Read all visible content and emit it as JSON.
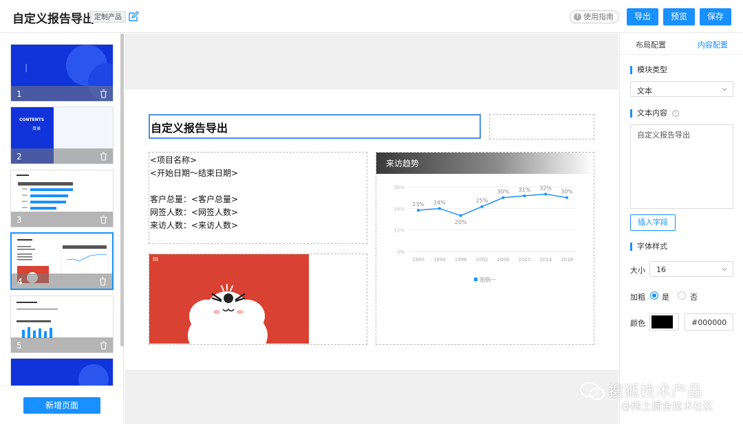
{
  "header": {
    "title": "自定义报告导出",
    "tag": "定制产品",
    "guide_label": "使用指南",
    "export_label": "导出",
    "preview_label": "预览",
    "save_label": "保存"
  },
  "pages": [
    {
      "num": "1"
    },
    {
      "num": "2",
      "contents_title": "CONTENTS",
      "contents_sub": "目录"
    },
    {
      "num": "3"
    },
    {
      "num": "4"
    },
    {
      "num": "5"
    }
  ],
  "add_page_label": "新增页面",
  "slide": {
    "title": "自定义报告导出",
    "text_lines": [
      "<项目名称>",
      "<开始日期～结束日期>",
      "",
      "客户总量：<客户总量>",
      "网签人数：<网签人数>",
      "来访人数：<来访人数>"
    ],
    "chart_header": "来访趋势"
  },
  "chart_data": {
    "type": "line",
    "title": "来访趋势",
    "categories": [
      "1990",
      "1994",
      "1998",
      "2002",
      "2006",
      "2010",
      "2014",
      "2018"
    ],
    "series": [
      {
        "name": "图例一",
        "values": [
          23,
          24,
          20,
          25,
          30,
          31,
          32,
          30
        ]
      }
    ],
    "data_labels": [
      "23%",
      "24%",
      "20%",
      "25%",
      "30%",
      "31%",
      "32%",
      "30%"
    ],
    "y_ticks": [
      "0%",
      "12%",
      "24%",
      "36%"
    ],
    "ylim": [
      0,
      36
    ],
    "grid": true,
    "legend": "bottom",
    "color": "#1890ff"
  },
  "panel": {
    "tab_layout": "布局配置",
    "tab_content": "内容配置",
    "module_type_label": "模块类型",
    "module_type_value": "文本",
    "text_content_label": "文本内容",
    "text_content_value": "自定义报告导出",
    "insert_field_label": "插入字段",
    "font_style_label": "字体样式",
    "size_label": "大小",
    "size_value": "16",
    "bold_label": "加粗",
    "bold_yes": "是",
    "bold_no": "否",
    "color_label": "颜色",
    "color_value": "#000000"
  },
  "watermark": {
    "line1": "搜狐技术产品",
    "line2": "@稀土掘金技术社区"
  },
  "colors": {
    "accent": "#1890ff",
    "slide_blue": "#1034d9",
    "image_red": "#d94132"
  }
}
